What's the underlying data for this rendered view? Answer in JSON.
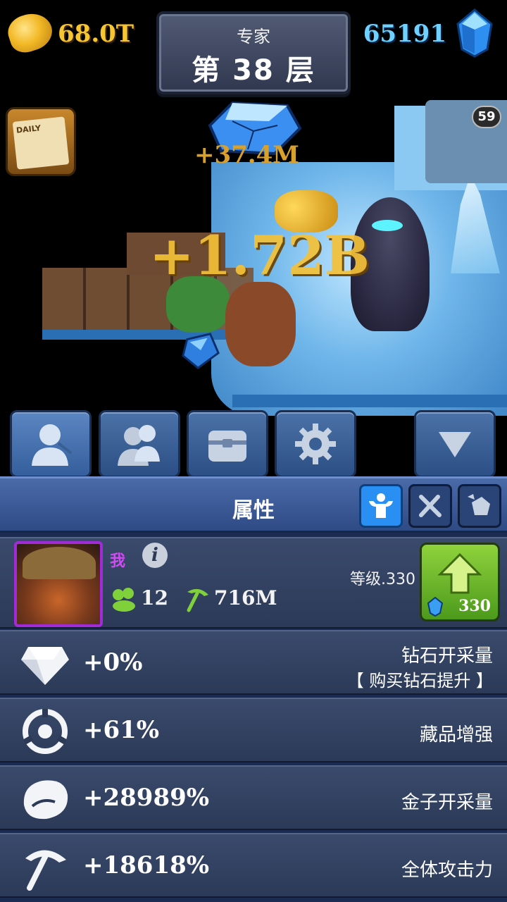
{
  "resources": {
    "gold": "68.0T",
    "gems": "65191"
  },
  "level": {
    "difficulty": "专家",
    "floor": "第 38 层"
  },
  "daily": {
    "label": "DAILY"
  },
  "floating_texts": {
    "small": "+37.4M",
    "big": "+1.72B"
  },
  "boss": {
    "level": "59"
  },
  "toolbar": {
    "buttons": [
      {
        "name": "hero",
        "icon": "miner-silhouette-icon",
        "active": true
      },
      {
        "name": "team",
        "icon": "miners-group-icon",
        "active": false
      },
      {
        "name": "chest",
        "icon": "chest-icon",
        "active": false
      },
      {
        "name": "settings",
        "icon": "gear-icon",
        "active": false
      },
      {
        "name": "collapse",
        "icon": "triangle-down-icon",
        "active": false
      }
    ]
  },
  "panel": {
    "title": "属性",
    "sub_tabs": [
      {
        "icon": "muscle-icon",
        "active": true
      },
      {
        "icon": "crossed-tools-icon",
        "active": false
      },
      {
        "icon": "ore-rock-icon",
        "active": false
      }
    ]
  },
  "profile": {
    "name": "我",
    "members": "12",
    "attack": "716M",
    "level_label": "等级.330",
    "upgrade_cost": "330"
  },
  "attributes": [
    {
      "icon": "diamond-icon",
      "value": "+0%",
      "label": "钻石开采量",
      "sublabel": "【 购买钻石提升 】"
    },
    {
      "icon": "target-ring-icon",
      "value": "+61%",
      "label": "藏品增强"
    },
    {
      "icon": "gold-ore-icon",
      "value": "+28989%",
      "label": "金子开采量"
    },
    {
      "icon": "pickaxe-icon",
      "value": "+18618%",
      "label": "全体攻击力"
    }
  ],
  "colors": {
    "gold_text": "#f7c531",
    "gem_text": "#6fd1ff",
    "panel_bg": "#1c2b52",
    "name_purple": "#d04cf2",
    "upgrade_green": "#6cb62a"
  }
}
